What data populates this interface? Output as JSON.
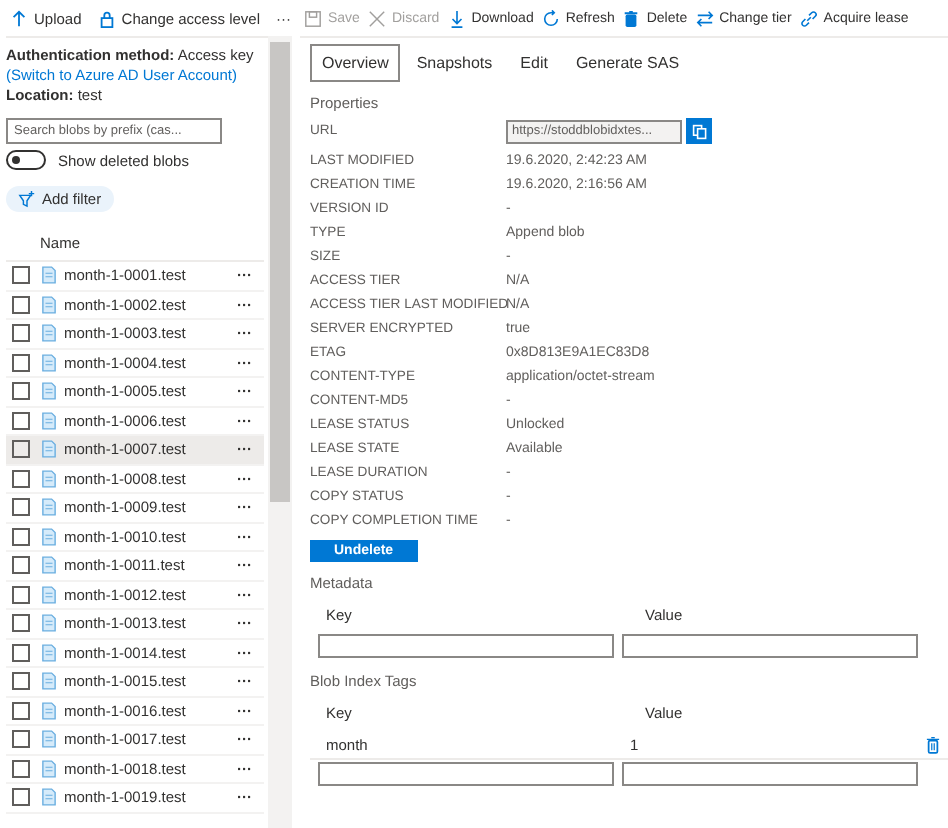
{
  "left_toolbar": [
    {
      "label": "Upload"
    },
    {
      "label": "Change access level"
    },
    {
      "label": "···"
    }
  ],
  "auth": {
    "label": "Authentication method:",
    "value": "Access key",
    "link": "(Switch to Azure AD User Account)"
  },
  "location": {
    "label": "Location:",
    "value": "test"
  },
  "search": {
    "placeholder": "Search blobs by prefix (cas..."
  },
  "show_deleted": {
    "label": "Show deleted blobs",
    "on": false
  },
  "add_filter": "Add filter",
  "list_header": "Name",
  "blobs": [
    {
      "name": "month-1-0001.test",
      "selected": false,
      "checked": false
    },
    {
      "name": "month-1-0002.test",
      "selected": false,
      "checked": false
    },
    {
      "name": "month-1-0003.test",
      "selected": false,
      "checked": false
    },
    {
      "name": "month-1-0004.test",
      "selected": false,
      "checked": false
    },
    {
      "name": "month-1-0005.test",
      "selected": false,
      "checked": false
    },
    {
      "name": "month-1-0006.test",
      "selected": false,
      "checked": false
    },
    {
      "name": "month-1-0007.test",
      "selected": true,
      "checked": false
    },
    {
      "name": "month-1-0008.test",
      "selected": false,
      "checked": false
    },
    {
      "name": "month-1-0009.test",
      "selected": false,
      "checked": false
    },
    {
      "name": "month-1-0010.test",
      "selected": false,
      "checked": false
    },
    {
      "name": "month-1-0011.test",
      "selected": false,
      "checked": false
    },
    {
      "name": "month-1-0012.test",
      "selected": false,
      "checked": false
    },
    {
      "name": "month-1-0013.test",
      "selected": false,
      "checked": false
    },
    {
      "name": "month-1-0014.test",
      "selected": false,
      "checked": false
    },
    {
      "name": "month-1-0015.test",
      "selected": false,
      "checked": false
    },
    {
      "name": "month-1-0016.test",
      "selected": false,
      "checked": false
    },
    {
      "name": "month-1-0017.test",
      "selected": false,
      "checked": false
    },
    {
      "name": "month-1-0018.test",
      "selected": false,
      "checked": false
    },
    {
      "name": "month-1-0019.test",
      "selected": false,
      "checked": false
    }
  ],
  "row_menu": "···",
  "right_toolbar": [
    {
      "label": "Save",
      "disabled": true
    },
    {
      "label": "Discard",
      "disabled": true
    },
    {
      "label": "Download",
      "disabled": false
    },
    {
      "label": "Refresh",
      "disabled": false
    },
    {
      "label": "Delete",
      "disabled": false
    },
    {
      "label": "Change tier",
      "disabled": false
    },
    {
      "label": "Acquire lease",
      "disabled": false
    }
  ],
  "tabs": [
    {
      "label": "Overview",
      "selected": true
    },
    {
      "label": "Snapshots",
      "selected": false
    },
    {
      "label": "Edit",
      "selected": false
    },
    {
      "label": "Generate SAS",
      "selected": false
    }
  ],
  "properties_title": "Properties",
  "properties": [
    {
      "label": "URL",
      "value": "https://stoddblobidxtes...",
      "kind": "url"
    },
    {
      "label": "LAST MODIFIED",
      "value": "19.6.2020, 2:42:23 AM",
      "kind": "text"
    },
    {
      "label": "CREATION TIME",
      "value": "19.6.2020, 2:16:56 AM",
      "kind": "text"
    },
    {
      "label": "VERSION ID",
      "value": "-",
      "kind": "text"
    },
    {
      "label": "TYPE",
      "value": "Append blob",
      "kind": "text"
    },
    {
      "label": "SIZE",
      "value": "-",
      "kind": "text"
    },
    {
      "label": "ACCESS TIER",
      "value": "N/A",
      "kind": "text"
    },
    {
      "label": "ACCESS TIER LAST MODIFIED",
      "value": "N/A",
      "kind": "text"
    },
    {
      "label": "SERVER ENCRYPTED",
      "value": "true",
      "kind": "text"
    },
    {
      "label": "ETAG",
      "value": "0x8D813E9A1EC83D8",
      "kind": "text"
    },
    {
      "label": "CONTENT-TYPE",
      "value": "application/octet-stream",
      "kind": "text"
    },
    {
      "label": "CONTENT-MD5",
      "value": "-",
      "kind": "text"
    },
    {
      "label": "LEASE STATUS",
      "value": "Unlocked",
      "kind": "text"
    },
    {
      "label": "LEASE STATE",
      "value": "Available",
      "kind": "text"
    },
    {
      "label": "LEASE DURATION",
      "value": "-",
      "kind": "text"
    },
    {
      "label": "COPY STATUS",
      "value": "-",
      "kind": "text"
    },
    {
      "label": "COPY COMPLETION TIME",
      "value": "-",
      "kind": "text"
    }
  ],
  "undelete": "Undelete",
  "metadata": {
    "title": "Metadata",
    "columns": [
      "Key",
      "Value"
    ]
  },
  "tags": {
    "title": "Blob Index Tags",
    "columns": [
      "Key",
      "Value"
    ],
    "rows": [
      {
        "key": "month",
        "value": "1"
      }
    ]
  }
}
